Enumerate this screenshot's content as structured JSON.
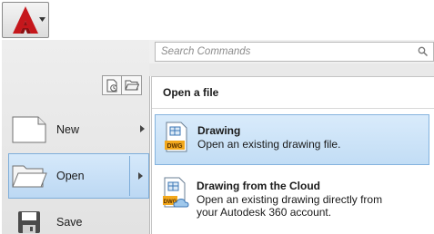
{
  "app": {
    "menu_button_icon": "autocad-logo-icon",
    "brand_color": "#c5171c"
  },
  "search": {
    "placeholder": "Search Commands",
    "icon": "search-icon"
  },
  "view_toggles": [
    {
      "icon": "recent-documents-icon"
    },
    {
      "icon": "open-documents-icon"
    }
  ],
  "menu": {
    "items": [
      {
        "label": "New",
        "icon": "new-document-icon",
        "has_submenu": true
      },
      {
        "label": "Open",
        "icon": "open-folder-icon",
        "has_submenu": true,
        "active": true
      },
      {
        "label": "Save",
        "icon": "save-disk-icon",
        "has_submenu": false
      }
    ]
  },
  "flyout": {
    "header": "Open a file",
    "items": [
      {
        "title": "Drawing",
        "description_lines": [
          "Open an existing drawing file."
        ],
        "icon": "dwg-file-icon",
        "highlighted": true
      },
      {
        "title": "Drawing from the Cloud",
        "description_lines": [
          "Open an existing drawing directly from",
          "your Autodesk 360 account."
        ],
        "icon": "dwg-cloud-icon",
        "highlighted": false
      }
    ]
  },
  "colors": {
    "accent_highlight": "#c2ddf5",
    "accent_border": "#84b3de"
  }
}
